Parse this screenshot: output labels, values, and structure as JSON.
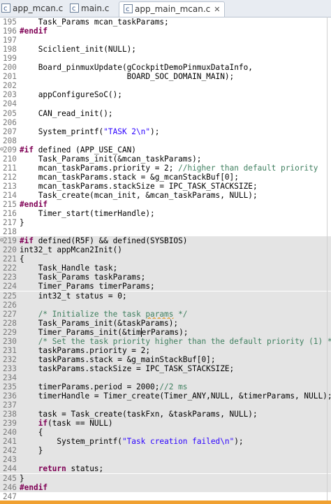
{
  "tabs": [
    {
      "label": "app_mcan.c",
      "active": false
    },
    {
      "label": "main.c",
      "active": false
    },
    {
      "label": "app_main_mcan.c",
      "active": true,
      "close": "✕"
    }
  ],
  "lines": [
    {
      "n": "195",
      "segs": [
        {
          "t": "    Task_Params mcan_taskParams;"
        }
      ]
    },
    {
      "n": "196",
      "segs": [
        {
          "t": "#endif",
          "c": "kw"
        }
      ]
    },
    {
      "n": "197",
      "segs": [
        {
          "t": ""
        }
      ]
    },
    {
      "n": "198",
      "segs": [
        {
          "t": "    Sciclient_init(NULL);"
        }
      ]
    },
    {
      "n": "199",
      "segs": [
        {
          "t": ""
        }
      ]
    },
    {
      "n": "200",
      "segs": [
        {
          "t": "    Board_pinmuxUpdate(gCockpitDemoPinmuxDataInfo,"
        }
      ]
    },
    {
      "n": "201",
      "segs": [
        {
          "t": "                       BOARD_SOC_DOMAIN_MAIN);"
        }
      ]
    },
    {
      "n": "202",
      "segs": [
        {
          "t": ""
        }
      ]
    },
    {
      "n": "203",
      "segs": [
        {
          "t": "    appConfigureSoC();"
        }
      ]
    },
    {
      "n": "204",
      "segs": [
        {
          "t": ""
        }
      ]
    },
    {
      "n": "205",
      "segs": [
        {
          "t": "    CAN_read_init();"
        }
      ]
    },
    {
      "n": "206",
      "segs": [
        {
          "t": ""
        }
      ]
    },
    {
      "n": "207",
      "segs": [
        {
          "t": "    System_printf("
        },
        {
          "t": "\"TASK 2\\n\"",
          "c": "st"
        },
        {
          "t": ");"
        }
      ]
    },
    {
      "n": "208",
      "segs": [
        {
          "t": ""
        }
      ]
    },
    {
      "n": "209",
      "fold": "⊖",
      "segs": [
        {
          "t": "#if",
          "c": "kw"
        },
        {
          "t": " defined (APP_USE_CAN)"
        }
      ]
    },
    {
      "n": "210",
      "segs": [
        {
          "t": "    Task_Params_init(&mcan_taskParams);"
        }
      ]
    },
    {
      "n": "211",
      "segs": [
        {
          "t": "    mcan_taskParams.priority = 2; "
        },
        {
          "t": "//higher than default priority",
          "c": "cm"
        }
      ]
    },
    {
      "n": "212",
      "segs": [
        {
          "t": "    mcan_taskParams.stack = &g_mcanStackBuf[0];"
        }
      ]
    },
    {
      "n": "213",
      "segs": [
        {
          "t": "    mcan_taskParams.stackSize = IPC_TASK_STACKSIZE;"
        }
      ]
    },
    {
      "n": "214",
      "segs": [
        {
          "t": "    Task_create(mcan_init, &mcan_taskParams, NULL);"
        }
      ]
    },
    {
      "n": "215",
      "segs": [
        {
          "t": "#endif",
          "c": "kw"
        }
      ]
    },
    {
      "n": "216",
      "segs": [
        {
          "t": "    Timer_start(timerHandle);"
        }
      ]
    },
    {
      "n": "217",
      "segs": [
        {
          "t": "}"
        }
      ]
    },
    {
      "n": "218",
      "segs": [
        {
          "t": ""
        }
      ]
    },
    {
      "n": "219",
      "hl": true,
      "fold": "⊖",
      "segs": [
        {
          "t": "#if",
          "c": "kw"
        },
        {
          "t": " defined(R5F) && defined(SYSBIOS)"
        }
      ]
    },
    {
      "n": "220",
      "hl": true,
      "segs": [
        {
          "t": "int32_t appMcan2Init()"
        }
      ]
    },
    {
      "n": "221",
      "hl": true,
      "segs": [
        {
          "t": "{"
        }
      ]
    },
    {
      "n": "222",
      "hl": true,
      "segs": [
        {
          "t": "    Task_Handle task;"
        }
      ]
    },
    {
      "n": "223",
      "hl": true,
      "segs": [
        {
          "t": "    Task_Params taskParams;"
        }
      ]
    },
    {
      "n": "224",
      "hl": true,
      "segs": [
        {
          "t": "    Timer_Params timerParams;"
        }
      ]
    },
    {
      "n": "225",
      "hl": true,
      "segs": [
        {
          "t": "    int32_t status = 0;"
        }
      ]
    },
    {
      "n": "226",
      "hl": true,
      "segs": [
        {
          "t": ""
        }
      ]
    },
    {
      "n": "227",
      "hl": true,
      "segs": [
        {
          "t": "    "
        },
        {
          "t": "/* Initialize the task ",
          "c": "cm"
        },
        {
          "t": "params",
          "c": "cm sq"
        },
        {
          "t": " */",
          "c": "cm"
        }
      ]
    },
    {
      "n": "228",
      "hl": true,
      "segs": [
        {
          "t": "    Task_Params_init(&taskParams);"
        }
      ]
    },
    {
      "n": "229",
      "hl": true,
      "segs": [
        {
          "t": "    Timer_Params_init(&tim"
        },
        {
          "t": "",
          "c": "caret"
        },
        {
          "t": "erParams);"
        }
      ]
    },
    {
      "n": "230",
      "hl": true,
      "segs": [
        {
          "t": "    "
        },
        {
          "t": "/* Set the task priority higher than the default priority (1) */",
          "c": "cm"
        }
      ]
    },
    {
      "n": "231",
      "hl": true,
      "segs": [
        {
          "t": "    taskParams.priority = 2;"
        }
      ]
    },
    {
      "n": "232",
      "hl": true,
      "segs": [
        {
          "t": "    taskParams.stack = &g_mainStackBuf[0];"
        }
      ]
    },
    {
      "n": "233",
      "hl": true,
      "segs": [
        {
          "t": "    taskParams.stackSize = IPC_TASK_STACKSIZE;"
        }
      ]
    },
    {
      "n": "234",
      "hl": true,
      "segs": [
        {
          "t": ""
        }
      ]
    },
    {
      "n": "235",
      "hl": true,
      "segs": [
        {
          "t": "    timerParams.period = 2000;"
        },
        {
          "t": "//2 ms",
          "c": "cm"
        }
      ]
    },
    {
      "n": "236",
      "hl": true,
      "segs": [
        {
          "t": "    timerHandle = Timer_create(Timer_ANY,NULL, &timerParams, NULL);"
        }
      ]
    },
    {
      "n": "237",
      "hl": true,
      "segs": [
        {
          "t": ""
        }
      ]
    },
    {
      "n": "238",
      "hl": true,
      "segs": [
        {
          "t": "    task = Task_create(taskFxn, &taskParams, NULL);"
        }
      ]
    },
    {
      "n": "239",
      "hl": true,
      "segs": [
        {
          "t": "    "
        },
        {
          "t": "if",
          "c": "kw"
        },
        {
          "t": "(task == NULL)"
        }
      ]
    },
    {
      "n": "240",
      "hl": true,
      "segs": [
        {
          "t": "    {"
        }
      ]
    },
    {
      "n": "241",
      "hl": true,
      "segs": [
        {
          "t": "        System_printf("
        },
        {
          "t": "\"Task creation failed\\n\"",
          "c": "st"
        },
        {
          "t": ");"
        }
      ]
    },
    {
      "n": "242",
      "hl": true,
      "segs": [
        {
          "t": "    }"
        }
      ]
    },
    {
      "n": "243",
      "hl": true,
      "segs": [
        {
          "t": ""
        }
      ]
    },
    {
      "n": "244",
      "hl": true,
      "segs": [
        {
          "t": "    "
        },
        {
          "t": "return",
          "c": "kw"
        },
        {
          "t": " status;"
        }
      ]
    },
    {
      "n": "245",
      "hl": true,
      "segs": [
        {
          "t": "}"
        }
      ]
    },
    {
      "n": "246",
      "hl": true,
      "segs": [
        {
          "t": "#endif",
          "c": "kw"
        }
      ]
    },
    {
      "n": "247",
      "segs": [
        {
          "t": ""
        }
      ]
    }
  ]
}
